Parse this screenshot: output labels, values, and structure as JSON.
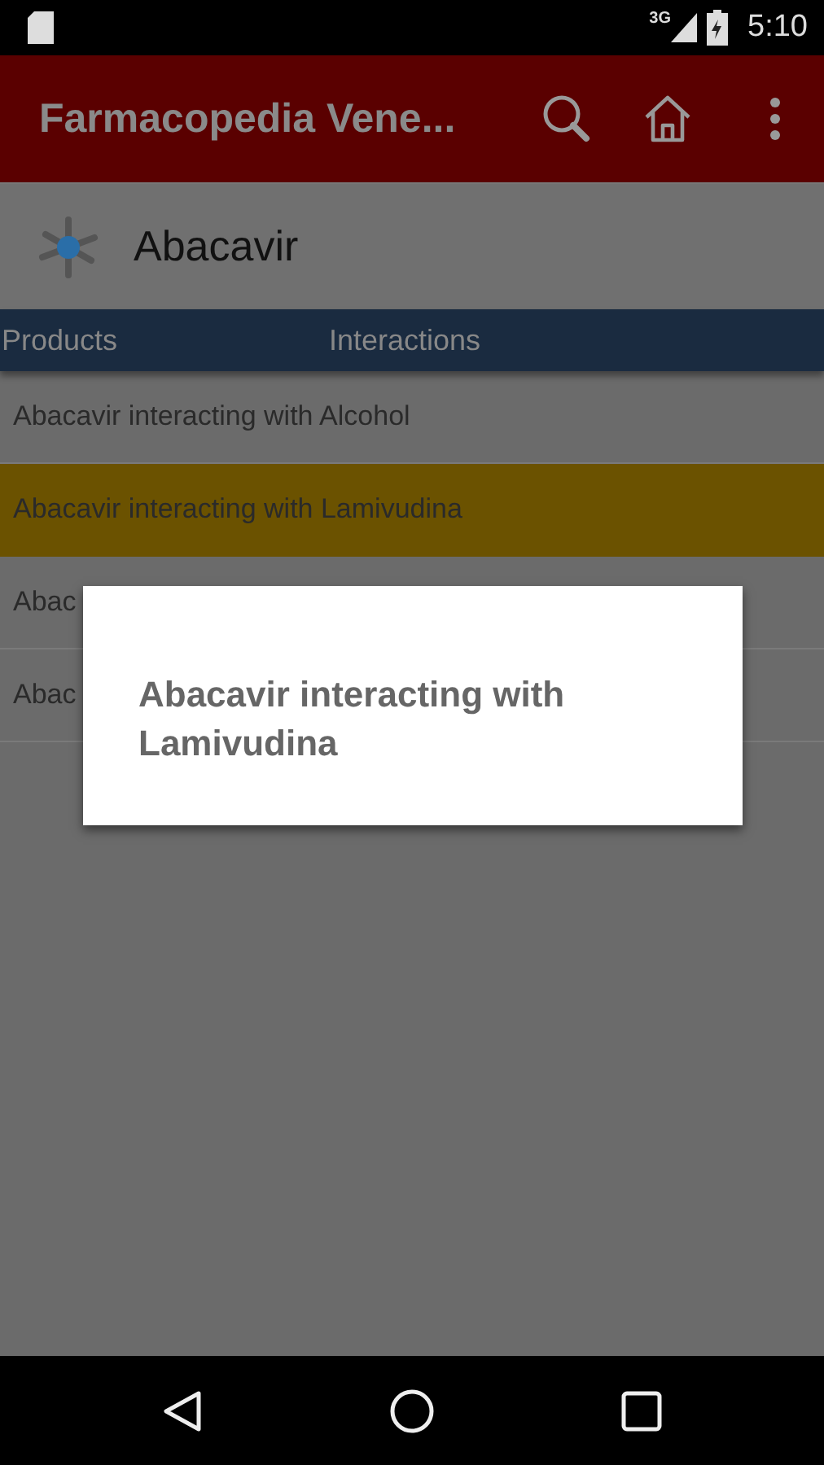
{
  "status_bar": {
    "network": "3G",
    "time": "5:10"
  },
  "app_bar": {
    "title": "Farmacopedia Vene..."
  },
  "header": {
    "title": "Abacavir"
  },
  "tabs": [
    {
      "label": "Products"
    },
    {
      "label": "Interactions"
    }
  ],
  "list": [
    {
      "text": "Abacavir interacting with Alcohol",
      "selected": false
    },
    {
      "text": "Abacavir interacting with Lamivudina",
      "selected": true
    },
    {
      "text": "Abac",
      "selected": false
    },
    {
      "text": "Abac",
      "selected": false
    }
  ],
  "dialog": {
    "message": "Abacavir interacting with Lamivudina"
  }
}
